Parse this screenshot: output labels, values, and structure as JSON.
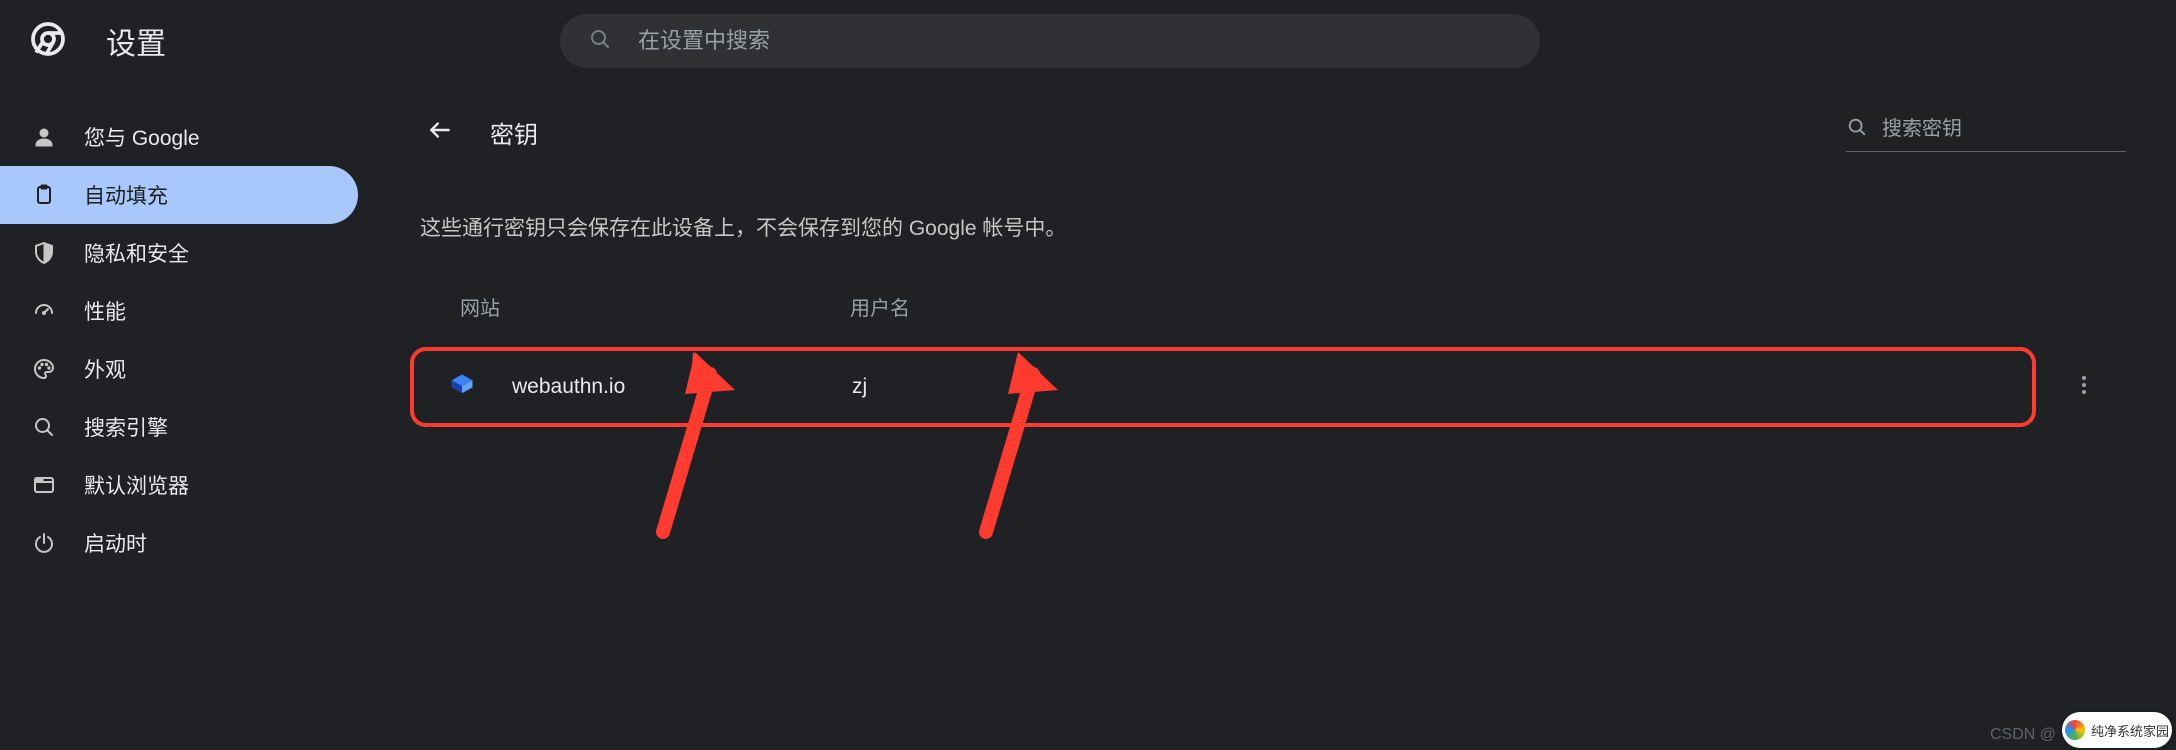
{
  "header": {
    "app_title": "设置",
    "search_placeholder": "在设置中搜索"
  },
  "sidebar": {
    "items": [
      {
        "id": "you-and-google",
        "label": "您与 Google"
      },
      {
        "id": "autofill",
        "label": "自动填充"
      },
      {
        "id": "privacy",
        "label": "隐私和安全"
      },
      {
        "id": "performance",
        "label": "性能"
      },
      {
        "id": "appearance",
        "label": "外观"
      },
      {
        "id": "search-engine",
        "label": "搜索引擎"
      },
      {
        "id": "default-browser",
        "label": "默认浏览器"
      },
      {
        "id": "on-startup",
        "label": "启动时"
      }
    ],
    "active_index": 1
  },
  "main": {
    "page_title": "密钥",
    "search_keys_placeholder": "搜索密钥",
    "description": "这些通行密钥只会保存在此设备上，不会保存到您的 Google 帐号中。",
    "columns": {
      "site": "网站",
      "username": "用户名"
    },
    "rows": [
      {
        "site": "webauthn.io",
        "username": "zj"
      }
    ]
  },
  "watermark": "CSDN @",
  "badge_text": "纯净系统家园"
}
